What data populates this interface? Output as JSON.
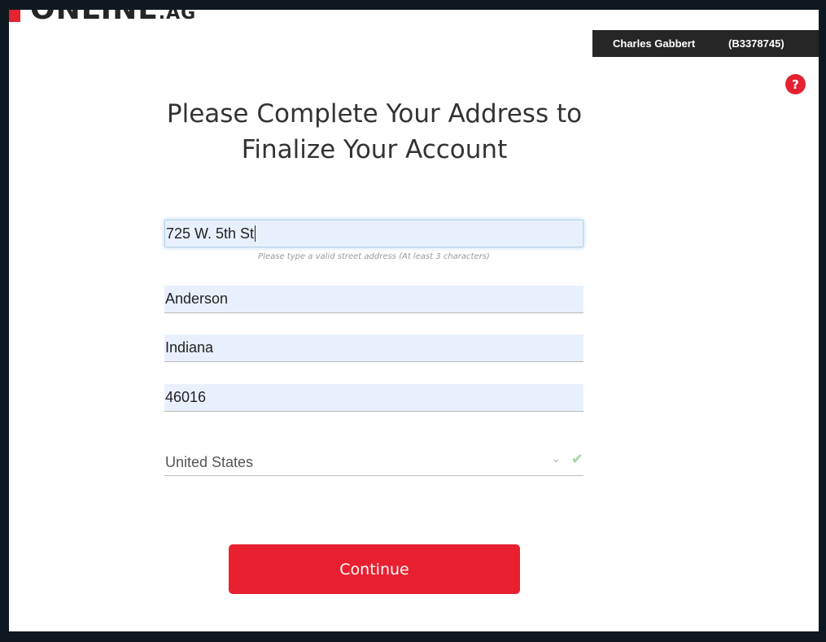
{
  "brand": {
    "logo_main": "ONLINE",
    "logo_sub": ".AG",
    "accent_color": "#e42230"
  },
  "header": {
    "user_name": "Charles Gabbert",
    "user_id": "(B3378745)",
    "help_label": "?"
  },
  "form": {
    "title": "Please Complete Your Address to Finalize Your Account",
    "street": "725 W. 5th St",
    "street_hint": "Please type a valid street address (At least 3 characters)",
    "city": "Anderson",
    "state": "Indiana",
    "zip": "46016",
    "country": "United States",
    "continue_label": "Continue"
  },
  "icons": {
    "help": "help-icon",
    "dropdown": "chevron-down-icon",
    "valid": "check-icon"
  }
}
